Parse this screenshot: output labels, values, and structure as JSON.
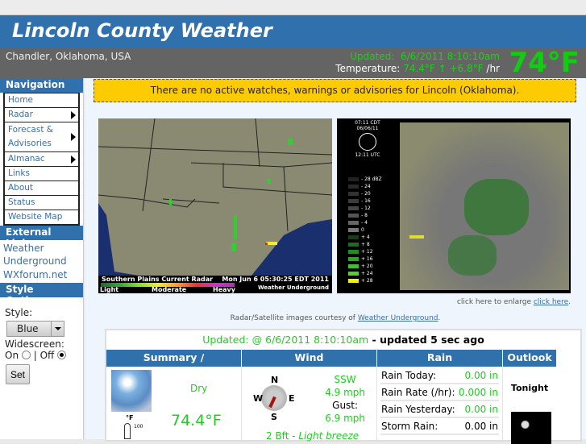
{
  "site": {
    "title": "Lincoln County Weather",
    "location": "Chandler, Oklahoma, USA",
    "updated_label": "Updated",
    "updated_value": "6/6/2011  8:10:10am",
    "temp_label": "Temperature:",
    "temp_value": "74.4°F",
    "temp_trend_icon": "arrow-up",
    "temp_rate": "+6.8°F",
    "temp_rate_unit": "/hr",
    "big_temp": "74°F"
  },
  "sidebar": {
    "nav_title": "Navigation",
    "nav": [
      {
        "label": "Home"
      },
      {
        "label": "Radar",
        "submenu": true
      },
      {
        "label": "Forecast & Advisories",
        "submenu": true
      },
      {
        "label": "Almanac",
        "submenu": true
      },
      {
        "label": "Links"
      },
      {
        "label": "About"
      },
      {
        "label": "Status"
      },
      {
        "label": "Website Map"
      }
    ],
    "ext_title": "External Links",
    "ext": [
      {
        "label": "Weather Underground"
      },
      {
        "label": "WXforum.net"
      }
    ],
    "style_title": "Style Options",
    "style_label": "Style:",
    "style_value": "Blue",
    "wide_label": "Widescreen:",
    "on_label": "On",
    "off_label": "| Off",
    "widescreen": "Off",
    "set_label": "Set"
  },
  "alert": "There are no active watches, warnings or advisories for Lincoln (Oklahoma).",
  "radar": {
    "left_title": "Southern Plains Current Radar",
    "left_time": "Mon Jun  6 05:30:25 EDT 2011",
    "left_scale": [
      "Light",
      "Moderate",
      "Heavy"
    ],
    "brand": "Weather Underground",
    "right_time": "07:11  CDT",
    "right_date": "06/06/11",
    "right_utc": "12:11  UTC",
    "right_scale": [
      "- 28 dBZ",
      "- 24",
      "- 20",
      "- 16",
      "- 12",
      "- 8",
      "- 4",
      "0",
      "+ 4",
      "+ 8",
      "+ 12",
      "+ 16",
      "+ 20",
      "+ 24",
      "+ 28"
    ]
  },
  "enlarge_text": "click here to enlarge",
  "enlarge_link": "click here",
  "courtesy_text": "Radar/Satellite images courtesy of",
  "courtesy_link": "Weather Underground",
  "current": {
    "updated_label": "Updated: @ 6/6/2011 8:10:10am",
    "updated_ago": " - updated 5 sec ago",
    "headers": [
      "Summary / Temperature",
      "Wind",
      "Rain",
      "Outlook"
    ],
    "condition": "Dry",
    "temperature": "74.4°F",
    "thermo_unit": "°F",
    "thermo_mark": "100",
    "wind_dir": "SSW",
    "wind_speed": "4.9 mph",
    "gust_label": "Gust:",
    "gust_speed": "6.9 mph",
    "compass": [
      "N",
      "E",
      "S",
      "W"
    ],
    "beaufort": "2 Bft -",
    "beaufort_desc": "Light breeze",
    "rain": [
      {
        "label": "Rain Today:",
        "value": "0.00 in"
      },
      {
        "label": "Rain Rate (/hr):",
        "value": "0.000 in"
      },
      {
        "label": "Rain Yesterday:",
        "value": "0.00 in"
      },
      {
        "label": "Storm Rain:",
        "value": "0.00 in"
      }
    ],
    "outlook_period": "Tonight"
  },
  "colors": {
    "brand_blue": "#3070ad",
    "green": "#22cc22",
    "alert": "#fdcc00"
  }
}
